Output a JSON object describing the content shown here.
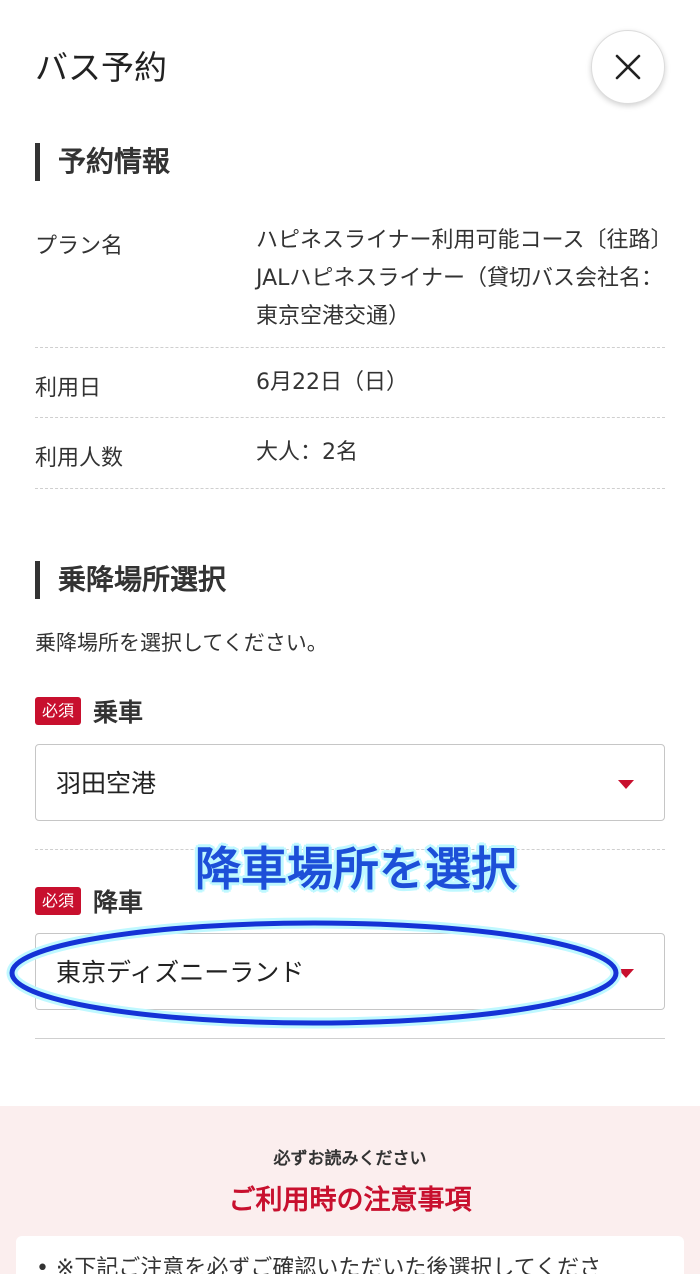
{
  "header": {
    "title": "バス予約"
  },
  "reservation": {
    "heading": "予約情報",
    "rows": [
      {
        "label": "プラン名",
        "value": "ハピネスライナー利用可能コース〔往路〕JALハピネスライナー（貸切バス会社名：東京空港交通）"
      },
      {
        "label": "利用日",
        "value": "6月22日（日）"
      },
      {
        "label": "利用人数",
        "value": "大人：2名"
      }
    ]
  },
  "stops": {
    "heading": "乗降場所選択",
    "instruction": "乗降場所を選択してください。",
    "required_badge": "必須",
    "boarding": {
      "label": "乗車",
      "value": "羽田空港"
    },
    "alighting": {
      "label": "降車",
      "value": "東京ディズニーランド"
    }
  },
  "annotation": {
    "text": "降車場所を選択",
    "color": "#1d4fd8"
  },
  "notice": {
    "subtitle": "必ずお読みください",
    "title": "ご利用時の注意事項",
    "item": "※下記ご注意を必ずご確認いただいた後選択してくださ"
  },
  "colors": {
    "accent": "#c8102e",
    "notice_bg": "#fbeeee"
  }
}
